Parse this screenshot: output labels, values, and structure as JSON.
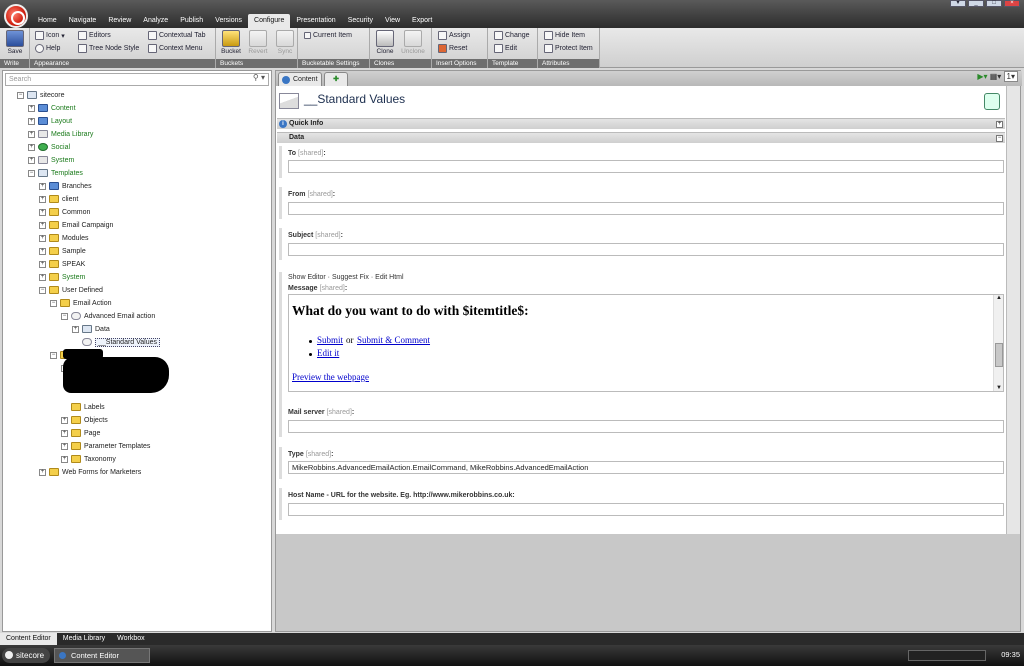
{
  "menu": {
    "tabs": [
      "Home",
      "Navigate",
      "Review",
      "Analyze",
      "Publish",
      "Versions",
      "Configure",
      "Presentation",
      "Security",
      "View",
      "Export"
    ],
    "active": "Configure"
  },
  "ribbon": {
    "write": {
      "save": "Save",
      "group": "Write"
    },
    "appearance": {
      "icon": "Icon",
      "help": "Help",
      "editors": "Editors",
      "tree_node_style": "Tree Node Style",
      "contextual_tab": "Contextual Tab",
      "context_menu": "Context Menu",
      "group": "Appearance"
    },
    "buckets": {
      "bucket": "Bucket",
      "revert": "Revert",
      "sync": "Sync",
      "group": "Buckets"
    },
    "bucketable": {
      "current_item": "Current Item",
      "group": "Bucketable Settings"
    },
    "clones": {
      "clone": "Clone",
      "unclone": "Unclone",
      "group": "Clones"
    },
    "insert_options": {
      "assign": "Assign",
      "reset": "Reset",
      "group": "Insert Options"
    },
    "template": {
      "change": "Change",
      "edit": "Edit",
      "group": "Template"
    },
    "attributes": {
      "hide_item": "Hide Item",
      "protect_item": "Protect Item",
      "group": "Attributes"
    }
  },
  "search": {
    "placeholder": "Search"
  },
  "tree": [
    {
      "label": "sitecore",
      "exp": "-",
      "icon": "tpl"
    },
    {
      "label": "Content",
      "exp": "+",
      "icon": "blue",
      "green": true
    },
    {
      "label": "Layout",
      "exp": "+",
      "icon": "blue",
      "green": true
    },
    {
      "label": "Media Library",
      "exp": "+",
      "icon": "grey",
      "green": true
    },
    {
      "label": "Social",
      "exp": "+",
      "icon": "green",
      "green": true
    },
    {
      "label": "System",
      "exp": "+",
      "icon": "grey",
      "green": true
    },
    {
      "label": "Templates",
      "exp": "-",
      "icon": "tpl",
      "green": true
    },
    {
      "label": "Branches",
      "exp": "+",
      "icon": "blue"
    },
    {
      "label": "client",
      "exp": "+",
      "icon": "folder"
    },
    {
      "label": "Common",
      "exp": "+",
      "icon": "folder"
    },
    {
      "label": "Email Campaign",
      "exp": "+",
      "icon": "folder"
    },
    {
      "label": "Modules",
      "exp": "+",
      "icon": "folder"
    },
    {
      "label": "Sample",
      "exp": "+",
      "icon": "folder"
    },
    {
      "label": "SPEAK",
      "exp": "+",
      "icon": "folder"
    },
    {
      "label": "System",
      "exp": "+",
      "icon": "folder",
      "green": true
    },
    {
      "label": "User Defined",
      "exp": "-",
      "icon": "folder"
    },
    {
      "label": "Email Action",
      "exp": "-",
      "icon": "folder"
    },
    {
      "label": "Advanced Email action",
      "exp": "-",
      "icon": "env"
    },
    {
      "label": "Data",
      "exp": "+",
      "icon": "tpl"
    },
    {
      "label": "__Standard Values",
      "exp": "",
      "icon": "env",
      "selected": true
    },
    {
      "label": "",
      "exp": "-",
      "icon": "folder"
    },
    {
      "label": "",
      "exp": "-",
      "icon": ""
    },
    {
      "label": "",
      "exp": "",
      "icon": ""
    },
    {
      "label": "",
      "exp": "",
      "icon": ""
    },
    {
      "label": "Labels",
      "exp": "",
      "icon": "folder"
    },
    {
      "label": "Objects",
      "exp": "+",
      "icon": "folder"
    },
    {
      "label": "Page",
      "exp": "+",
      "icon": "folder"
    },
    {
      "label": "Parameter Templates",
      "exp": "+",
      "icon": "folder"
    },
    {
      "label": "Taxonomy",
      "exp": "+",
      "icon": "folder"
    },
    {
      "label": "Web Forms for Marketers",
      "exp": "+",
      "icon": "folder"
    }
  ],
  "content_tab": {
    "label": "Content"
  },
  "item": {
    "title": "__Standard Values"
  },
  "sections": {
    "quick_info": "Quick Info",
    "data": "Data"
  },
  "shared_tag": "[shared]",
  "fields": {
    "to": {
      "label": "To",
      "value": ""
    },
    "from": {
      "label": "From",
      "value": ""
    },
    "subject": {
      "label": "Subject",
      "value": ""
    },
    "message": {
      "label": "Message"
    },
    "mail_server": {
      "label": "Mail server",
      "value": ""
    },
    "type": {
      "label": "Type",
      "value": "MikeRobbins.AdvancedEmailAction.EmailCommand, MikeRobbins.AdvancedEmailAction"
    },
    "host_name": {
      "label": "Host Name - URL for the website. Eg. http://www.mikerobbins.co.uk",
      "value": ""
    }
  },
  "field_links": "Show Editor · Suggest Fix · Edit Html",
  "message_body": {
    "heading": "What do you want to do with $itemtitle$:",
    "submit": "Submit",
    "or": "or",
    "submit_comment": "Submit & Comment",
    "edit_it": "Edit it",
    "preview": "Preview the webpage"
  },
  "bottom_tabs": [
    "Content Editor",
    "Media Library",
    "Workbox"
  ],
  "taskbar": {
    "start": "sitecore",
    "app": "Content Editor",
    "time": "09:35"
  }
}
